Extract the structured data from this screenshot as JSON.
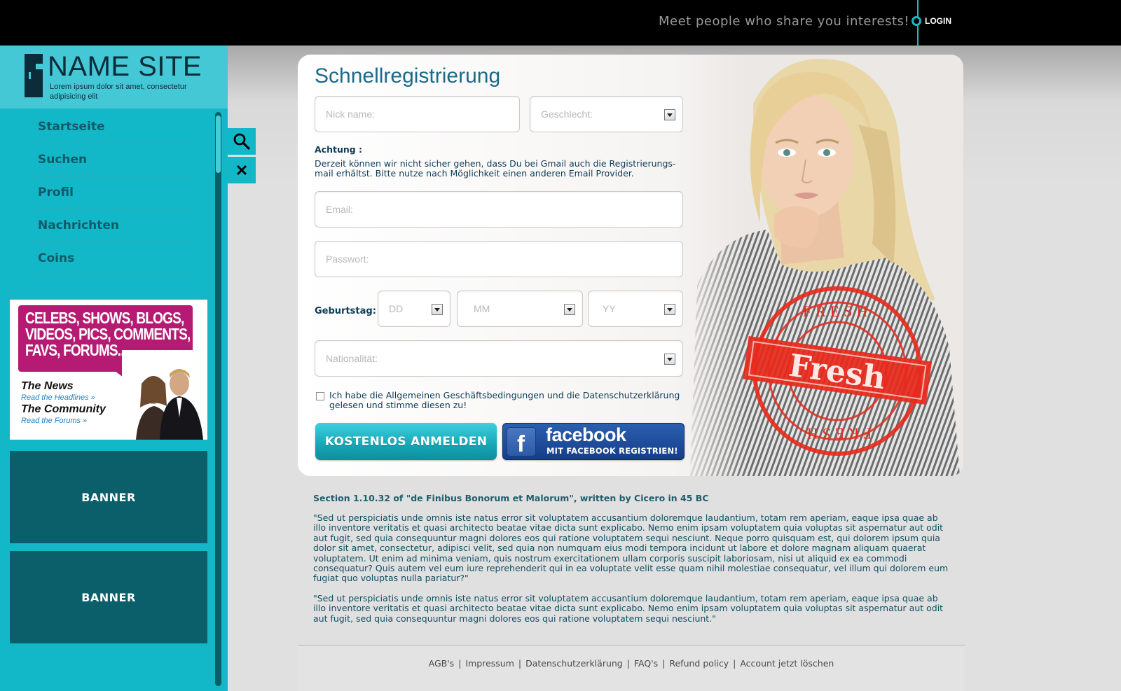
{
  "topbar": {
    "tagline": "Meet people who share you interests!",
    "login_label": "LOGIN"
  },
  "logo": {
    "title": "NAME SITE",
    "subtitle": "Lorem ipsum dolor sit amet, consectetur adipisicing elit"
  },
  "nav": {
    "items": [
      {
        "label": "Startseite"
      },
      {
        "label": "Suchen"
      },
      {
        "label": "Profil"
      },
      {
        "label": "Nachrichten"
      },
      {
        "label": "Coins"
      }
    ]
  },
  "promo": {
    "headline": "CELEBS, SHOWS, BLOGS, VIDEOS, PICS, COMMENTS, FAVS, FORUMS...",
    "news_title": "The News",
    "news_link": "Read the Headlines »",
    "community_title": "The Community",
    "community_link": "Read the Forums »"
  },
  "banners": [
    {
      "label": "BANNER"
    },
    {
      "label": "BANNER"
    }
  ],
  "form": {
    "title": "Schnellregistrierung",
    "nick_placeholder": "Nick name:",
    "gender_placeholder": "Geschlecht:",
    "warning_title": "Achtung :",
    "warning_text": "Derzeit können wir nicht sicher gehen, dass Du bei Gmail auch die Registrierungs-mail erhältst. Bitte nutze nach Möglichkeit einen anderen Email Provider.",
    "email_placeholder": "Email:",
    "password_placeholder": "Passwort:",
    "birthday_label": "Geburtstag:",
    "day_placeholder": "DD",
    "month_placeholder": "MM",
    "year_placeholder": "YY",
    "nationality_placeholder": "Nationalität:",
    "agb_text": "Ich habe die Allgemeinen Geschäftsbedingungen und die Datenschutzerklärung gelesen und stimme diesen zu!",
    "register_label": "KOSTENLOS ANMELDEN",
    "facebook_word": "facebook",
    "facebook_sub": "MIT FACEBOOK REGISTRIEN!",
    "stamp_word": "Fresh",
    "stamp_ring_text": "FRESH"
  },
  "article": {
    "heading": "Section 1.10.32 of \"de Finibus Bonorum et Malorum\", written by Cicero in 45 BC",
    "paragraph1": "\"Sed ut perspiciatis unde omnis iste natus error sit voluptatem accusantium doloremque laudantium, totam rem aperiam, eaque ipsa quae ab illo inventore veritatis et quasi architecto beatae vitae dicta sunt explicabo. Nemo enim ipsam voluptatem quia voluptas sit aspernatur aut odit aut fugit, sed quia consequuntur magni dolores eos qui ratione voluptatem sequi nesciunt. Neque porro quisquam est, qui dolorem ipsum quia dolor sit amet, consectetur, adipisci velit, sed quia non numquam eius modi tempora incidunt ut labore et dolore magnam aliquam quaerat voluptatem. Ut enim ad minima veniam, quis nostrum exercitationem ullam corporis suscipit laboriosam, nisi ut aliquid ex ea commodi consequatur? Quis autem vel eum iure reprehenderit qui in ea voluptate velit esse quam nihil molestiae consequatur, vel illum qui dolorem eum fugiat quo voluptas nulla pariatur?\"",
    "paragraph2": "\"Sed ut perspiciatis unde omnis iste natus error sit voluptatem accusantium doloremque laudantium, totam rem aperiam, eaque ipsa quae ab illo inventore veritatis et quasi architecto beatae vitae dicta sunt explicabo. Nemo enim ipsam voluptatem quia voluptas sit aspernatur aut odit aut fugit, sed quia consequuntur magni dolores eos qui ratione voluptatem sequi nesciunt.\""
  },
  "footer": {
    "links": [
      {
        "label": "AGB's"
      },
      {
        "label": "Impressum"
      },
      {
        "label": "Datenschutzerklärung"
      },
      {
        "label": "FAQ's"
      },
      {
        "label": "Refund policy"
      },
      {
        "label": "Account jetzt löschen"
      }
    ],
    "separator": "|"
  },
  "icons": {
    "search": "search-icon",
    "close": "close-icon",
    "login": "login-dot-icon",
    "dropdown": "chevron-down-icon",
    "facebook": "facebook-icon"
  },
  "colors": {
    "accent": "#13b8c8",
    "banner": "#0a5f6a",
    "promo": "#b51b73",
    "facebook": "#1e4c9a",
    "stamp": "#e8291b"
  }
}
